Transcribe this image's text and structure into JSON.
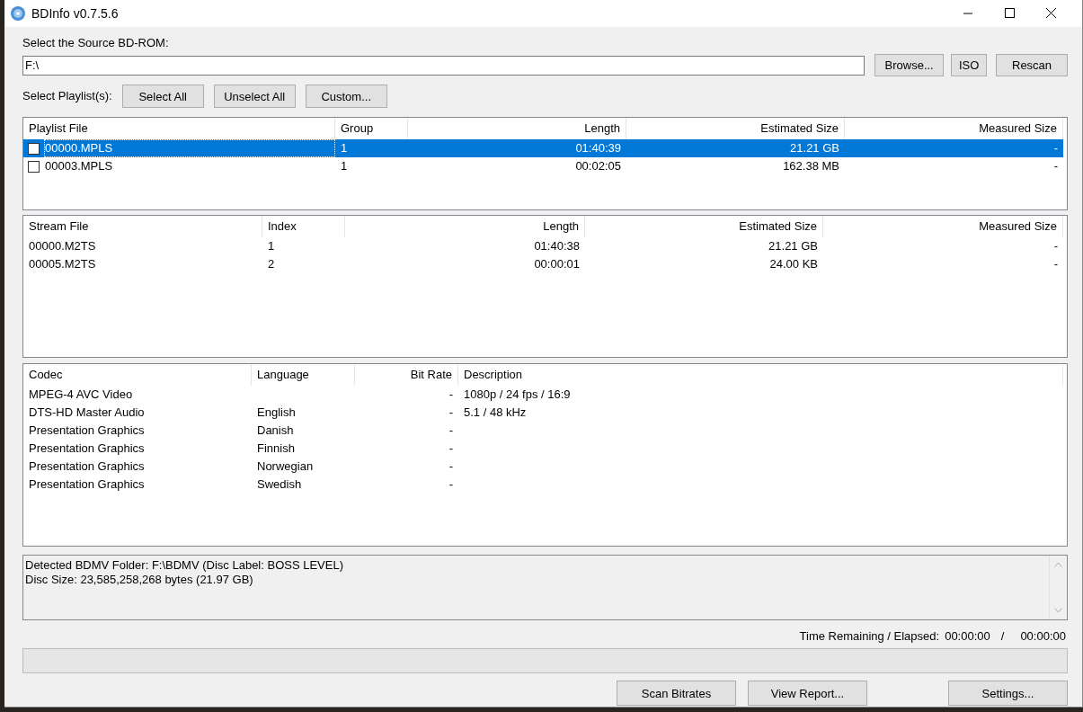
{
  "window": {
    "title": "BDInfo v0.7.5.6"
  },
  "source": {
    "label": "Select the Source BD-ROM:",
    "value": "F:\\",
    "buttons": [
      "Browse...",
      "ISO",
      "Rescan"
    ]
  },
  "playlist_select": {
    "label": "Select Playlist(s):",
    "buttons": [
      "Select All",
      "Unselect All",
      "Custom..."
    ]
  },
  "playlist_table": {
    "columns": [
      "Playlist File",
      "Group",
      "Length",
      "Estimated Size",
      "Measured Size"
    ],
    "rows": [
      {
        "selected": true,
        "checked": false,
        "cells": [
          "00000.MPLS",
          "1",
          "01:40:39",
          "21.21 GB",
          "-"
        ]
      },
      {
        "selected": false,
        "checked": false,
        "cells": [
          "00003.MPLS",
          "1",
          "00:02:05",
          "162.38 MB",
          "-"
        ]
      }
    ]
  },
  "stream_table": {
    "columns": [
      "Stream File",
      "Index",
      "Length",
      "Estimated Size",
      "Measured Size"
    ],
    "rows": [
      [
        "00000.M2TS",
        "1",
        "01:40:38",
        "21.21 GB",
        "-"
      ],
      [
        "00005.M2TS",
        "2",
        "00:00:01",
        "24.00 KB",
        "-"
      ]
    ]
  },
  "codec_table": {
    "columns": [
      "Codec",
      "Language",
      "Bit Rate",
      "Description"
    ],
    "rows": [
      [
        "MPEG-4 AVC Video",
        "",
        "-",
        "1080p / 24 fps / 16:9"
      ],
      [
        "DTS-HD Master Audio",
        "English",
        "-",
        "5.1 / 48 kHz"
      ],
      [
        "Presentation Graphics",
        "Danish",
        "-",
        ""
      ],
      [
        "Presentation Graphics",
        "Finnish",
        "-",
        ""
      ],
      [
        "Presentation Graphics",
        "Norwegian",
        "-",
        ""
      ],
      [
        "Presentation Graphics",
        "Swedish",
        "-",
        ""
      ]
    ]
  },
  "info_box": {
    "lines": [
      "Detected BDMV Folder: F:\\BDMV (Disc Label: BOSS LEVEL)",
      "Disc Size: 23,585,258,268 bytes (21.97 GB)"
    ]
  },
  "time": {
    "label": "Time Remaining / Elapsed:",
    "remaining": "00:00:00",
    "separator": "/",
    "elapsed": "00:00:00"
  },
  "progress": {
    "level": 0
  },
  "bottom_buttons": [
    "Scan Bitrates",
    "View Report...",
    "Settings..."
  ]
}
